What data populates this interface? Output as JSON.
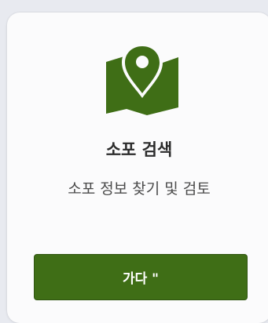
{
  "card": {
    "title": "소포 검색",
    "subtitle": "소포 정보 찾기 및 검토",
    "button_label": "가다 \"",
    "icon": "map-pin-icon",
    "accent_color": "#3f6e16"
  }
}
